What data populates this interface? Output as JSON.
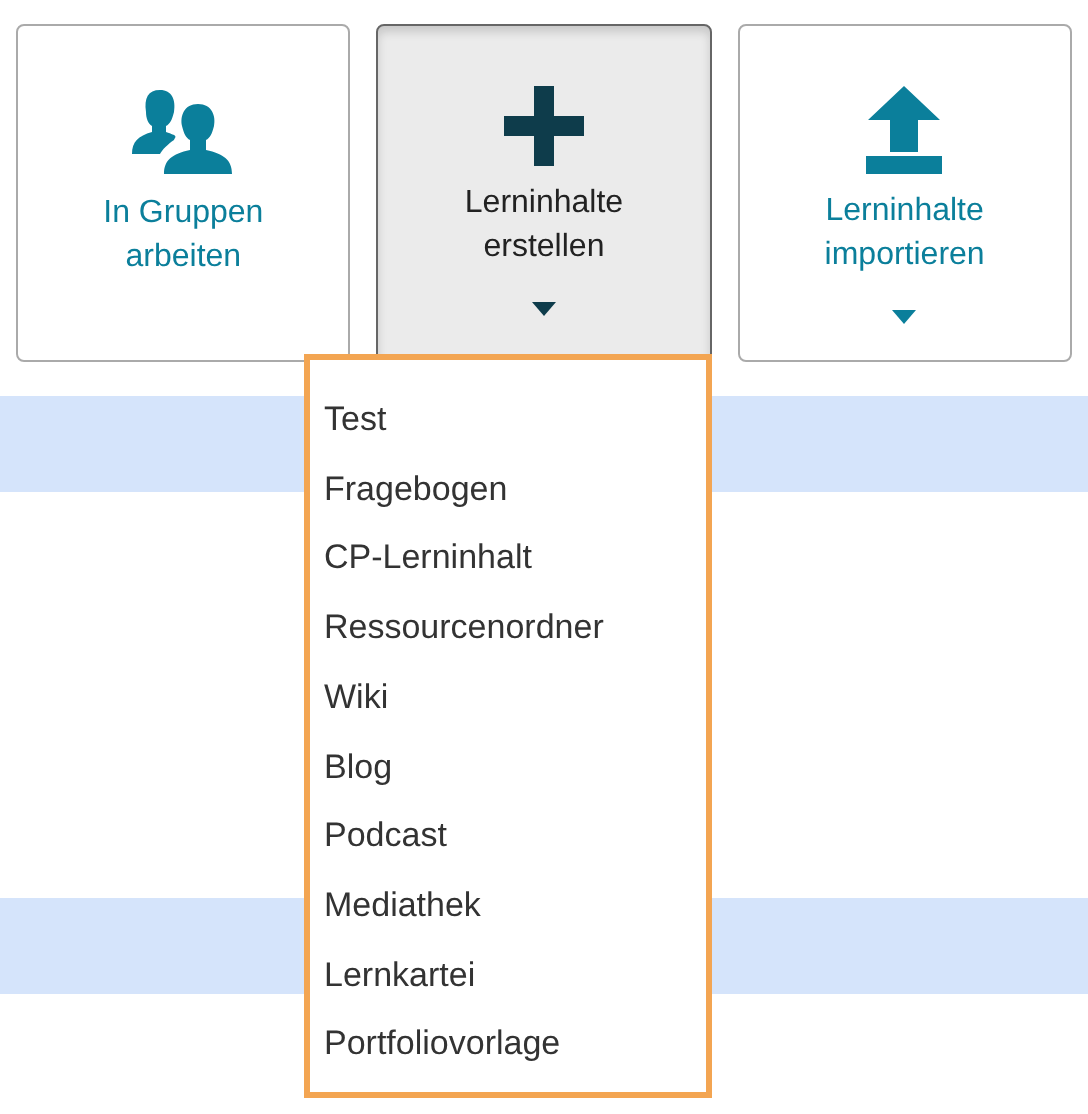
{
  "buttons": [
    {
      "kind": "group",
      "label": "In Gruppen arbeiten",
      "caret": false,
      "selected": false
    },
    {
      "kind": "create",
      "label": "Lerninhalte erstellen",
      "caret": true,
      "selected": true
    },
    {
      "kind": "import",
      "label": "Lerninhalte importieren",
      "caret": true,
      "selected": false
    }
  ],
  "menu": {
    "items": [
      "Test",
      "Fragebogen",
      "CP-Lerninhalt",
      "Ressourcenordner",
      "Wiki",
      "Blog",
      "Podcast",
      "Mediathek",
      "Lernkartei",
      "Portfoliovorlage"
    ]
  }
}
